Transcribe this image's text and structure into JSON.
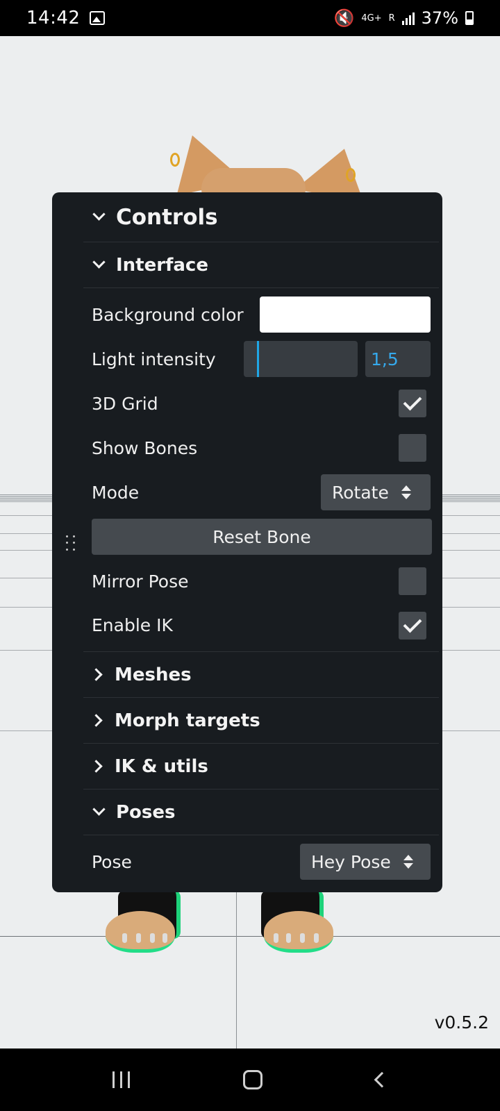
{
  "status_bar": {
    "time": "14:42",
    "network": "4G+",
    "roaming": "R",
    "battery": "37%"
  },
  "panel": {
    "title": "Controls",
    "interface": {
      "title": "Interface",
      "background_color_label": "Background color",
      "background_color_value": "#ffffff",
      "light_intensity_label": "Light intensity",
      "light_intensity_value": "1,5",
      "grid_label": "3D Grid",
      "grid_checked": true,
      "show_bones_label": "Show Bones",
      "show_bones_checked": false,
      "mode_label": "Mode",
      "mode_value": "Rotate",
      "reset_bone_label": "Reset Bone",
      "mirror_pose_label": "Mirror Pose",
      "mirror_pose_checked": false,
      "enable_ik_label": "Enable IK",
      "enable_ik_checked": true
    },
    "folders": {
      "meshes": "Meshes",
      "morph_targets": "Morph targets",
      "ik_utils": "IK & utils"
    },
    "poses": {
      "title": "Poses",
      "pose_label": "Pose",
      "pose_value": "Hey Pose"
    }
  },
  "version": "v0.5.2"
}
